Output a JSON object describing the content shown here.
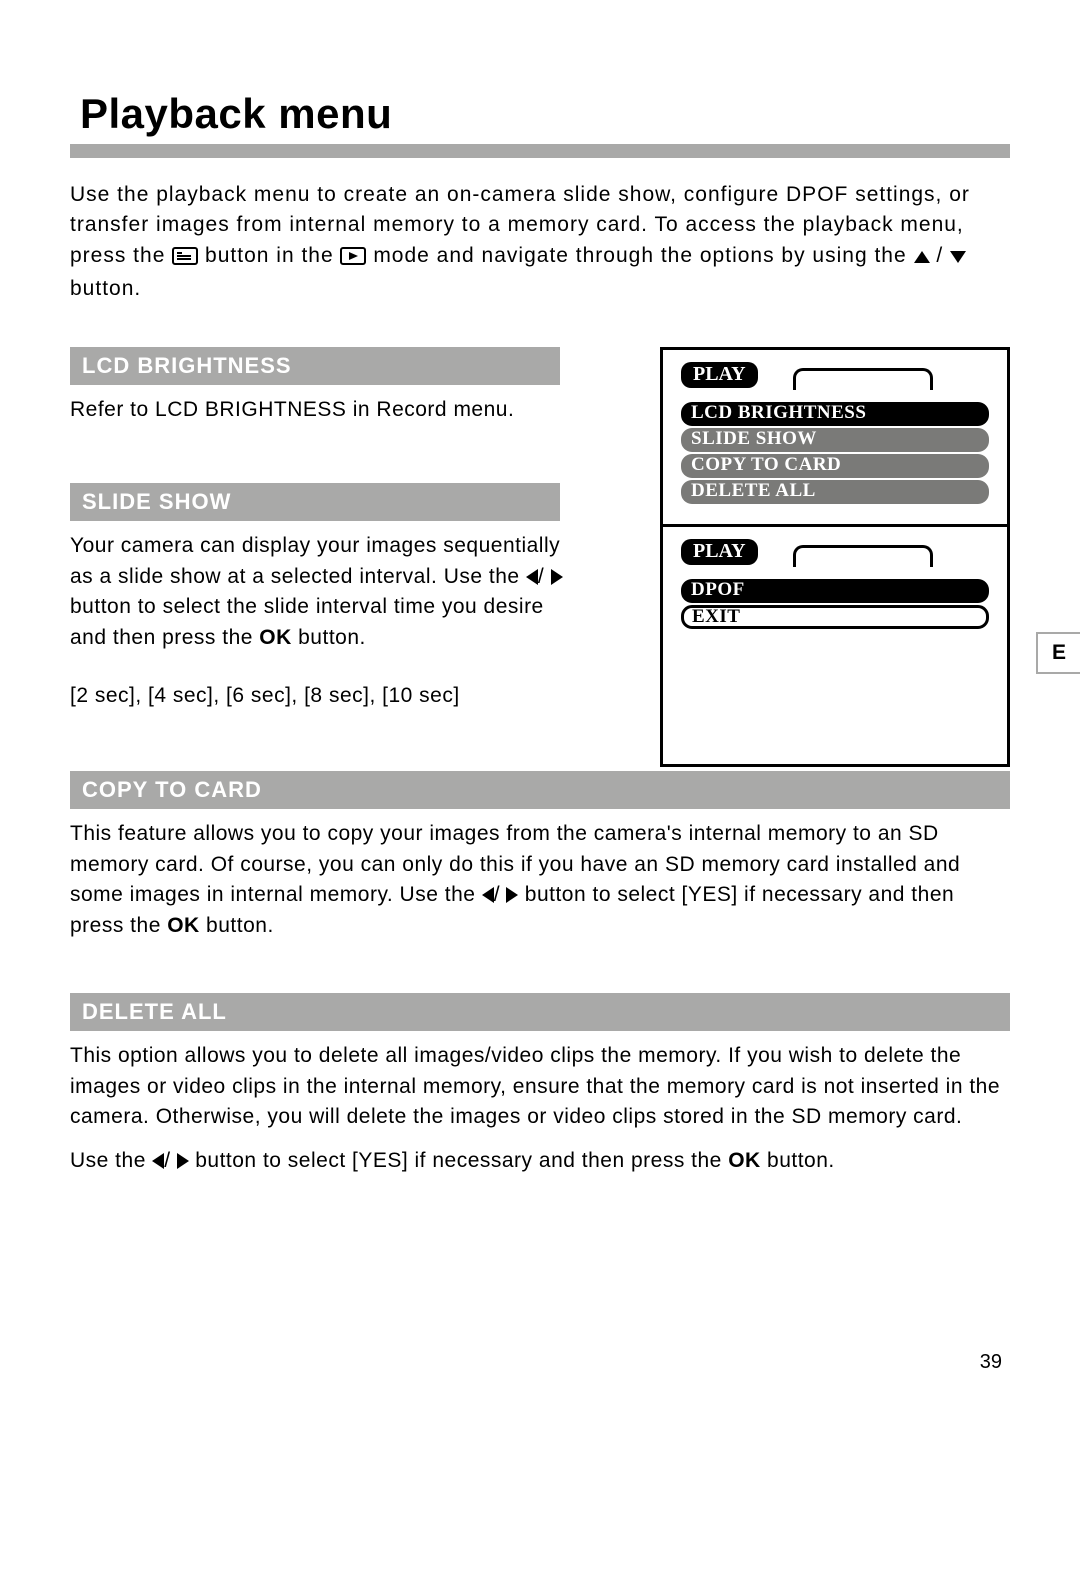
{
  "page": {
    "title": "Playback menu",
    "number": "39",
    "side_tab": "E"
  },
  "intro": {
    "part1": "Use the playback menu to create an on-camera slide show, configure DPOF settings, or transfer images from internal memory to a memory card. To access the playback menu, press the ",
    "part2": " button in the ",
    "part3": " mode and navigate through the options by using the ",
    "slash": " / ",
    "part4": " button."
  },
  "sections": {
    "lcd_brightness": {
      "heading": "LCD BRIGHTNESS",
      "body": "Refer to LCD BRIGHTNESS in Record menu."
    },
    "slide_show": {
      "heading": "SLIDE SHOW",
      "body_a": "Your camera can display your images sequen­tially as a slide show at a selected interval. Use the ",
      "slash": "/ ",
      "body_b": " button to select the slide interval time you desire and then press the ",
      "ok": "OK",
      "body_c": " button.",
      "intervals": "[2 sec], [4 sec], [6 sec], [8 sec], [10 sec]"
    },
    "copy_to_card": {
      "heading": "COPY TO CARD",
      "body_a": "This feature allows you to copy your images from the camera's internal memory to an SD memory card. Of course, you can only do this if you have an SD memory card installed and some images in internal memory. Use the ",
      "slash": "/ ",
      "body_b": " button to select [YES] if necessary and then press the ",
      "ok": "OK",
      "body_c": " button."
    },
    "delete_all": {
      "heading": "DELETE ALL",
      "body1": "This option allows you to delete all images/video clips the memory. If you wish to delete the images or video clips in the internal memory, ensure that the memory card is not inserted in the camera.  Otherwise, you will delete the images or video clips stored in the SD memory card.",
      "body2_a": "Use the ",
      "slash": "/ ",
      "body2_b": " button to select [YES] if necessary and then press the ",
      "ok": "OK",
      "body2_c": " button."
    }
  },
  "lcd_screens": {
    "top": {
      "tab": "PLAY",
      "items": [
        "LCD  BRIGHTNESS",
        "SLIDE  SHOW",
        "COPY  TO  CARD",
        "DELETE ALL"
      ],
      "selected_index": 0
    },
    "bottom": {
      "tab": "PLAY",
      "items": [
        "DPOF",
        "EXIT"
      ],
      "selected_index": 0
    }
  }
}
